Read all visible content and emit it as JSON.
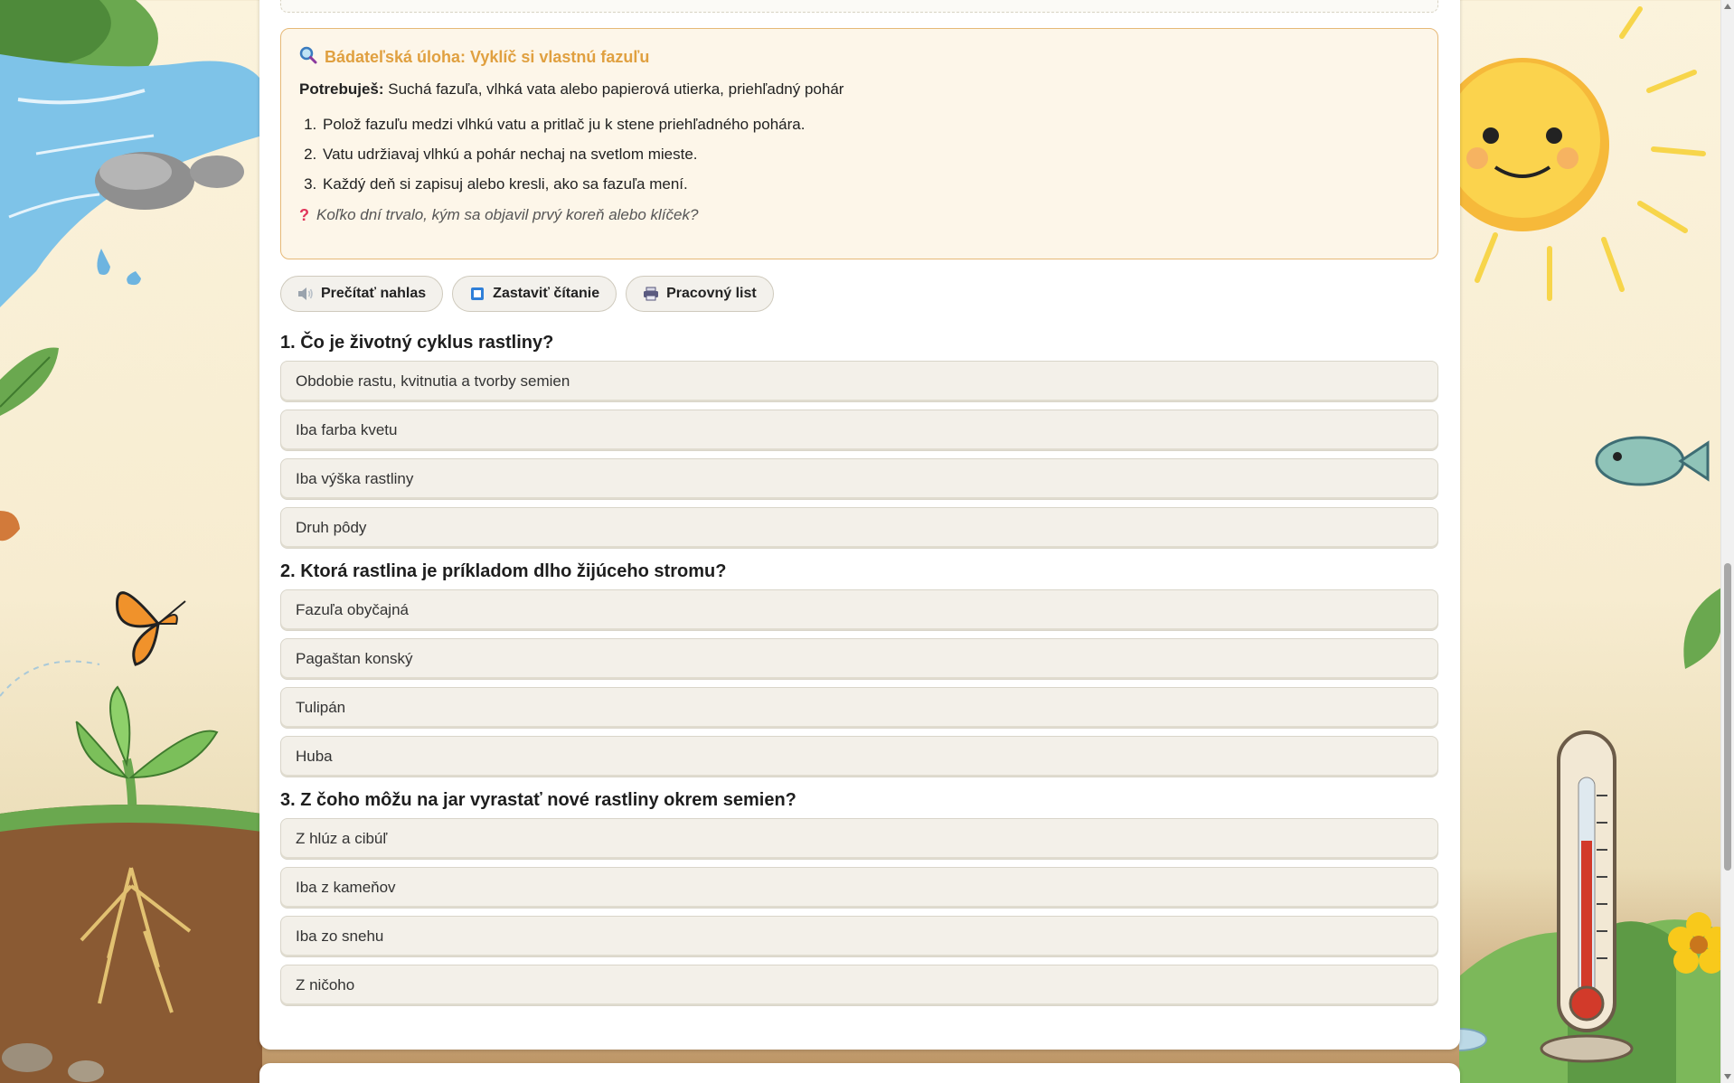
{
  "task": {
    "icon": "magnifier-icon",
    "title": "Bádateľská úloha: Vyklíč si vlastnú fazuľu",
    "needs_label": "Potrebuješ:",
    "needs_text": "Suchá fazuľa, vlhká vata alebo papierová utierka, priehľadný pohár",
    "steps": [
      "Polož fazuľu medzi vlhkú vatu a pritlač ju k stene priehľadného pohára.",
      "Vatu udržiavaj vlhkú a pohár nechaj na svetlom mieste.",
      "Každý deň si zapisuj alebo kresli, ako sa fazuľa mení."
    ],
    "question": "Koľko dní trvalo, kým sa objavil prvý koreň alebo klíček?"
  },
  "actions": {
    "read_aloud": "Prečítať nahlas",
    "stop_reading": "Zastaviť čítanie",
    "worksheet": "Pracovný list"
  },
  "quiz": [
    {
      "title": "1. Čo je životný cyklus rastliny?",
      "options": [
        "Obdobie rastu, kvitnutia a tvorby semien",
        "Iba farba kvetu",
        "Iba výška rastliny",
        "Druh pôdy"
      ]
    },
    {
      "title": "2. Ktorá rastlina je príkladom dlho žijúceho stromu?",
      "options": [
        "Fazuľa obyčajná",
        "Pagaštan konský",
        "Tulipán",
        "Huba"
      ]
    },
    {
      "title": "3. Z čoho môžu na jar vyrastať nové rastliny okrem semien?",
      "options": [
        "Z hlúz a cibúľ",
        "Iba z kameňov",
        "Iba zo snehu",
        "Z ničoho"
      ]
    }
  ],
  "colors": {
    "task_title": "#e0a040",
    "task_border": "#e6b977",
    "question_mark": "#e0355a"
  }
}
